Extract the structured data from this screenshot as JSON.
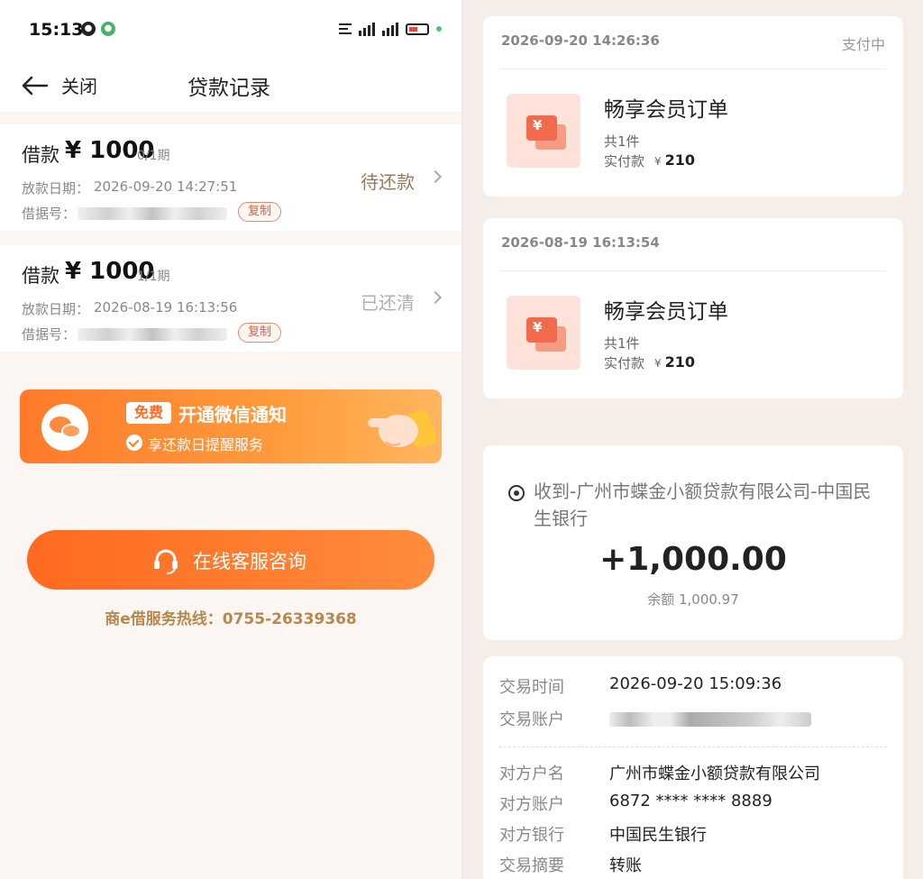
{
  "status_bar": {
    "time": "15:13"
  },
  "nav": {
    "close_label": "关闭",
    "title": "贷款记录"
  },
  "loans": [
    {
      "title": "借款",
      "amount": "¥ 1000",
      "period": "0/1期",
      "date_label": "放款日期：",
      "date": "2026-09-20 14:27:51",
      "id_label": "借据号：",
      "copy_label": "复制",
      "status": "待还款",
      "status_color": "#9a7a5a"
    },
    {
      "title": "借款",
      "amount": "¥ 1000",
      "period": "1/1期",
      "date_label": "放款日期：",
      "date": "2026-08-19 16:13:56",
      "id_label": "借据号：",
      "copy_label": "复制",
      "status": "已还清",
      "status_color": "#b0b0b0"
    }
  ],
  "wechat_banner": {
    "free_tag": "免费",
    "title": "开通微信通知",
    "subtitle": "享还款日提醒服务"
  },
  "customer_service": {
    "label": "在线客服咨询",
    "hotline": "商e借服务热线：0755-26339368"
  },
  "orders": [
    {
      "date": "2026-09-20 14:26:36",
      "status": "支付中",
      "name": "畅享会员订单",
      "count": "共1件",
      "paid_label": "实付款",
      "currency": "¥",
      "paid": "210"
    },
    {
      "date": "2026-08-19 16:13:54",
      "status": "",
      "name": "畅享会员订单",
      "count": "共1件",
      "paid_label": "实付款",
      "currency": "¥",
      "paid": "210"
    }
  ],
  "receipt": {
    "from": "收到-广州市蝶金小额贷款有限公司-中国民生银行",
    "amount": "+1,000.00",
    "balance": "余额 1,000.97"
  },
  "details": {
    "time_label": "交易时间",
    "time": "2026-09-20 15:09:36",
    "account_label": "交易账户",
    "payee_name_label": "对方户名",
    "payee_name": "广州市蝶金小额贷款有限公司",
    "payee_account_label": "对方账户",
    "payee_account": "6872 **** **** 8889",
    "payee_bank_label": "对方银行",
    "payee_bank": "中国民生银行",
    "summary_label": "交易摘要",
    "summary": "转账"
  },
  "colors": {
    "accent": "#ff6a20",
    "hotline": "#b4884e",
    "copy_border": "#e08a72"
  }
}
